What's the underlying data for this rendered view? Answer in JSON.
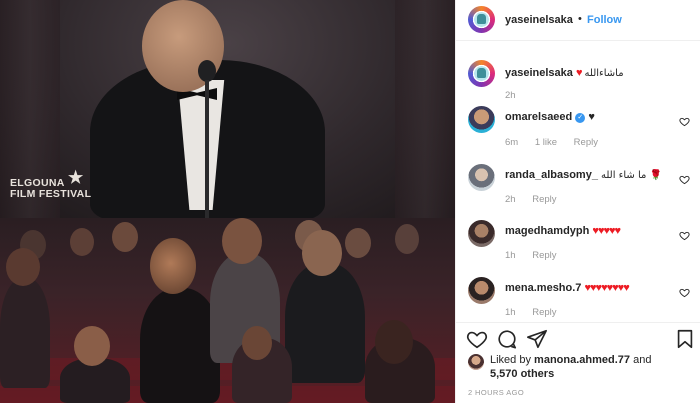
{
  "post": {
    "author": "yaseinelsaka",
    "follow_label": "Follow",
    "separator": "•"
  },
  "media": {
    "logo_line1": "ELGOUNA",
    "logo_line2": "FILM FESTIVAL"
  },
  "caption": {
    "username": "yaseinelsaka",
    "text": "ماشاءالله",
    "time": "2h"
  },
  "comments": [
    {
      "username": "omarelsaeed",
      "verified": true,
      "text": "♥",
      "time": "6m",
      "likes": "1 like",
      "reply": "Reply"
    },
    {
      "username": "randa_albasomy_",
      "text": "ما شاء الله 🌹",
      "time": "2h",
      "reply": "Reply"
    },
    {
      "username": "magedhamdyph",
      "text": "♥♥♥♥♥",
      "time": "1h",
      "reply": "Reply"
    },
    {
      "username": "mena.mesho.7",
      "text": "♥♥♥♥♥♥♥♥",
      "time": "1h",
      "reply": "Reply"
    }
  ],
  "likes": {
    "prefix": "Liked by",
    "user": "manona.ahmed.77",
    "and": "and",
    "count": "5,570 others"
  },
  "timestamp": "2 HOURS AGO",
  "colors": {
    "accent": "#3897f0",
    "heart": "#ed1c24",
    "muted": "#999999",
    "text": "#262626"
  },
  "icons": [
    "heart-icon",
    "comment-icon",
    "share-icon",
    "bookmark-icon",
    "verified-icon"
  ]
}
